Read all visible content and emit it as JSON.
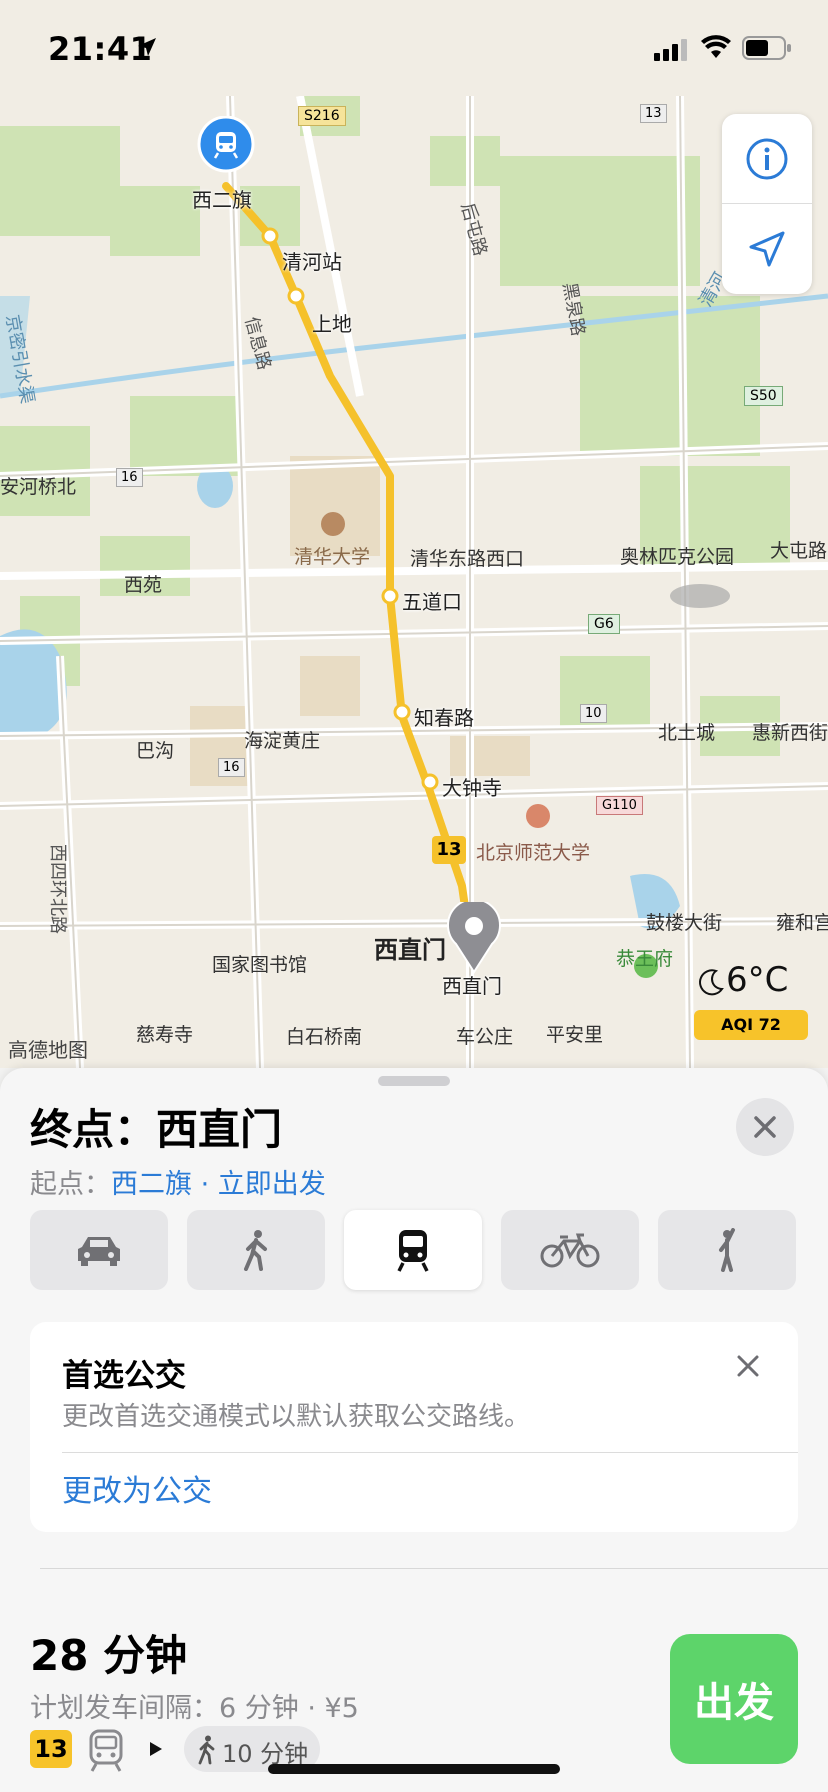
{
  "status_bar": {
    "time": "21:41"
  },
  "map": {
    "route_badge": "13",
    "origin_station": "西二旗",
    "destination_station": "西直门",
    "stations": [
      "清河站",
      "上地",
      "五道口",
      "知春路",
      "大钟寺"
    ],
    "labels": {
      "l1": "清华大学",
      "l2": "清华东路西口",
      "l3": "奥林匹克公园",
      "l4": "大屯路",
      "l5": "西苑",
      "l6": "海淀黄庄",
      "l7": "巴沟",
      "l8": "北土城",
      "l9": "惠新西街",
      "l10": "北京师范大学",
      "l11": "鼓楼大街",
      "l12": "雍和宫",
      "l13": "国家图书馆",
      "l14": "恭王府",
      "l15": "慈寿寺",
      "l16": "白石桥南",
      "l17": "车公庄",
      "l18": "平安里",
      "l19": "安河桥北",
      "l20": "西直门",
      "road1": "信息路",
      "road2": "后屯路",
      "road3": "黑泉路",
      "road4": "京密引水渠",
      "road5": "西四环北路",
      "road6": "清河"
    },
    "highway_shields": {
      "s216": "S216",
      "s50": "S50",
      "g6": "G6",
      "g110": "G110",
      "n13": "13",
      "n16a": "16",
      "n16b": "16",
      "n10": "10"
    },
    "weather": {
      "temp": "6°C",
      "aqi": "AQI 72"
    },
    "attribution": "高德地图"
  },
  "sheet": {
    "destination": "终点：西直门",
    "origin_prefix": "起点：",
    "origin_name": "西二旗",
    "origin_sep": " · ",
    "depart_now": "立即出发",
    "modes": [
      "car-icon",
      "walk-icon",
      "transit-icon",
      "bike-icon",
      "rideshare-icon"
    ],
    "preference_card": {
      "title": "首选公交",
      "description": "更改首选交通模式以默认获取公交路线。",
      "action": "更改为公交"
    },
    "route": {
      "duration": "28 分钟",
      "interval": "计划发车间隔：6 分钟 · ¥5",
      "line_badge": "13",
      "walk": "10 分钟",
      "go_label": "出发"
    }
  },
  "colors": {
    "route": "#f5c12b",
    "accent_blue": "#2b7bd6",
    "go_green": "#5dd46a",
    "park": "#cfe3b4",
    "water": "#a9d3ea"
  }
}
